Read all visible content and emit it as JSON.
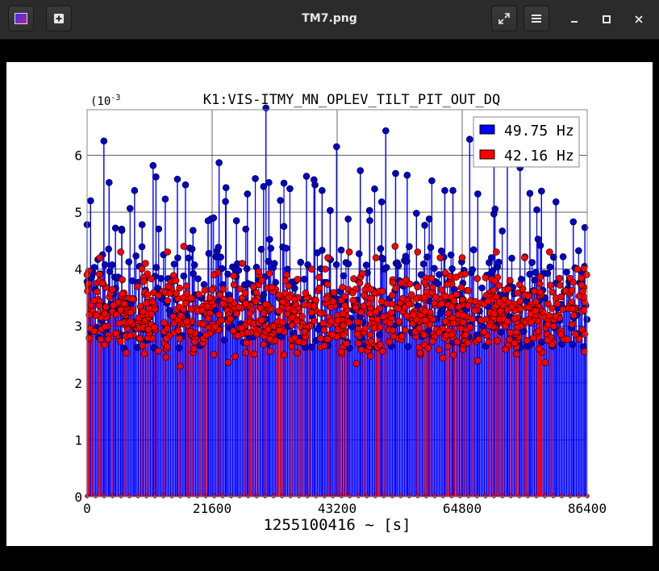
{
  "window": {
    "title": "TM7.png",
    "icons": [
      "app-icon",
      "new-tab-icon",
      "fullscreen-icon",
      "menu-icon",
      "minimize-icon",
      "maximize-icon",
      "close-icon"
    ]
  },
  "chart_data": {
    "type": "scatter",
    "title": "K1:VIS-ITMY_MN_OPLEV_TILT_PIT_OUT_DQ",
    "xlabel": "1255100416 ~ [s]",
    "ylabel": "",
    "y_scale_label": "(10",
    "y_scale_exp": "-3",
    "xlim": [
      0,
      86400
    ],
    "ylim": [
      0,
      0.0068
    ],
    "xticks": [
      "0",
      "21600",
      "43200",
      "64800",
      "86400"
    ],
    "yticks": [
      "0",
      "1",
      "2",
      "3",
      "4",
      "5",
      "6"
    ],
    "grid": true,
    "legend_position": "top-right",
    "series": [
      {
        "name": "49.75 Hz",
        "color": "#0000ff",
        "marker_color": "#0000cc",
        "style": "stem",
        "peaks": [
          [
            0,
            0.00478
          ],
          [
            600,
            0.0052
          ],
          [
            2900,
            0.00625
          ],
          [
            3800,
            0.00552
          ],
          [
            4900,
            0.00472
          ],
          [
            6000,
            0.00468
          ],
          [
            8200,
            0.00538
          ],
          [
            9500,
            0.00478
          ],
          [
            11400,
            0.00582
          ],
          [
            11900,
            0.00562
          ],
          [
            13500,
            0.00523
          ],
          [
            15600,
            0.00558
          ],
          [
            17000,
            0.00548
          ],
          [
            18300,
            0.00468
          ],
          [
            20900,
            0.00485
          ],
          [
            22800,
            0.00587
          ],
          [
            24000,
            0.00543
          ],
          [
            25800,
            0.00485
          ],
          [
            27700,
            0.00532
          ],
          [
            30500,
            0.00545
          ],
          [
            30900,
            0.00683
          ],
          [
            31400,
            0.00552
          ],
          [
            34000,
            0.00475
          ],
          [
            37900,
            0.00563
          ],
          [
            39200,
            0.00557
          ],
          [
            40600,
            0.00538
          ],
          [
            42000,
            0.00503
          ],
          [
            43100,
            0.00615
          ],
          [
            45100,
            0.00488
          ],
          [
            47200,
            0.00573
          ],
          [
            48800,
            0.00503
          ],
          [
            50900,
            0.00518
          ],
          [
            51600,
            0.00643
          ],
          [
            53300,
            0.00568
          ],
          [
            55300,
            0.00565
          ],
          [
            56900,
            0.00498
          ],
          [
            59100,
            0.00488
          ],
          [
            61800,
            0.00538
          ],
          [
            63200,
            0.00538
          ],
          [
            66100,
            0.00628
          ],
          [
            67500,
            0.00532
          ],
          [
            70300,
            0.00588
          ],
          [
            72600,
            0.00608
          ],
          [
            74800,
            0.00578
          ],
          [
            76500,
            0.00533
          ],
          [
            78500,
            0.00537
          ],
          [
            81000,
            0.00518
          ],
          [
            84000,
            0.00483
          ],
          [
            86000,
            0.00473
          ]
        ]
      },
      {
        "name": "42.16 Hz",
        "color": "#ff0000",
        "marker_color": "#ff0000",
        "style": "stem",
        "peaks": [
          [
            0,
            0.0039
          ],
          [
            2200,
            0.0042
          ],
          [
            5800,
            0.0043
          ],
          [
            10100,
            0.0041
          ],
          [
            13900,
            0.0043
          ],
          [
            16700,
            0.0044
          ],
          [
            21900,
            0.0039
          ],
          [
            26800,
            0.0041
          ],
          [
            30200,
            0.0038
          ],
          [
            34500,
            0.0039
          ],
          [
            38800,
            0.004
          ],
          [
            41600,
            0.0042
          ],
          [
            45300,
            0.0043
          ],
          [
            49900,
            0.0042
          ],
          [
            53200,
            0.0044
          ],
          [
            57100,
            0.0043
          ],
          [
            61000,
            0.0042
          ],
          [
            64800,
            0.0042
          ],
          [
            70700,
            0.0043
          ],
          [
            75600,
            0.0042
          ],
          [
            79900,
            0.0043
          ],
          [
            84700,
            0.004
          ],
          [
            86300,
            0.0039
          ]
        ],
        "band": [
          0.0022,
          0.0042
        ],
        "band_center": 0.003
      }
    ]
  }
}
